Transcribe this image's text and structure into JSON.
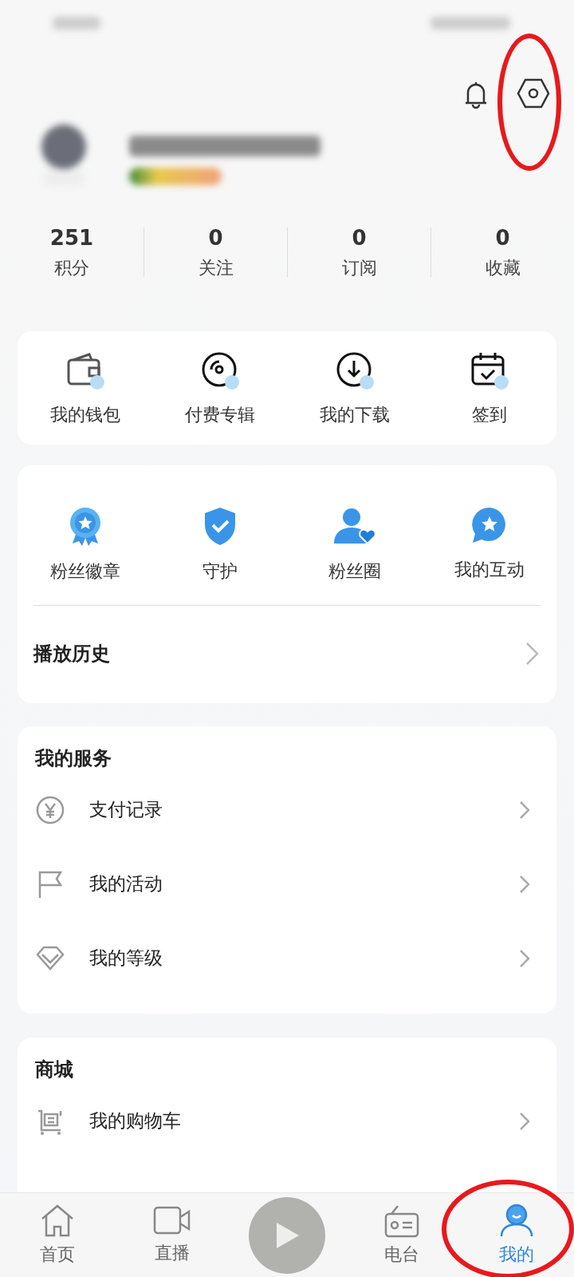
{
  "stats": [
    {
      "value": "251",
      "label": "积分"
    },
    {
      "value": "0",
      "label": "关注"
    },
    {
      "value": "0",
      "label": "订阅"
    },
    {
      "value": "0",
      "label": "收藏"
    }
  ],
  "quick_actions": [
    {
      "label": "我的钱包"
    },
    {
      "label": "付费专辑"
    },
    {
      "label": "我的下载"
    },
    {
      "label": "签到"
    }
  ],
  "fan_actions": [
    {
      "label": "粉丝徽章"
    },
    {
      "label": "守护"
    },
    {
      "label": "粉丝圈"
    },
    {
      "label": "我的互动"
    }
  ],
  "history": {
    "title": "播放历史"
  },
  "services": {
    "title": "我的服务",
    "items": [
      {
        "label": "支付记录"
      },
      {
        "label": "我的活动"
      },
      {
        "label": "我的等级"
      }
    ]
  },
  "mall": {
    "title": "商城",
    "items": [
      {
        "label": "我的购物车"
      }
    ]
  },
  "tab_bar": {
    "tabs": [
      {
        "label": "首页",
        "selected": false
      },
      {
        "label": "直播",
        "selected": false
      },
      {
        "label": "电台",
        "selected": false
      },
      {
        "label": "我的",
        "selected": true
      }
    ]
  }
}
